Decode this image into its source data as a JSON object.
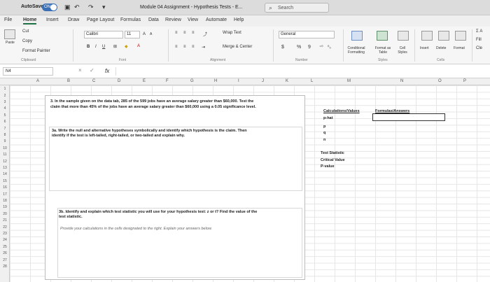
{
  "titlebar": {
    "autosave_label": "AutoSave",
    "autosave_state": "ON",
    "title": "Module 04 Assignment - Hypothesis Tests - E...",
    "search_placeholder": "Search"
  },
  "tabs": [
    "File",
    "Home",
    "Insert",
    "Draw",
    "Page Layout",
    "Formulas",
    "Data",
    "Review",
    "View",
    "Automate",
    "Help"
  ],
  "ribbon": {
    "clipboard": {
      "cut": "Cut",
      "copy": "Copy",
      "paste": "Paste",
      "format_painter": "Format Painter",
      "label": "Clipboard"
    },
    "font": {
      "name": "Calibri",
      "size": "11",
      "bold": "B",
      "italic": "I",
      "underline": "U",
      "grow": "A",
      "shrink": "A",
      "label": "Font"
    },
    "alignment": {
      "wrap": "Wrap Text",
      "merge": "Merge & Center",
      "label": "Alignment"
    },
    "number": {
      "format": "General",
      "currency": "$",
      "percent": "%",
      "comma": "9",
      "label": "Number"
    },
    "styles": {
      "conditional": "Conditional Formatting",
      "format_table": "Format as Table",
      "cell_styles": "Cell Styles",
      "label": "Styles"
    },
    "cells": {
      "insert": "Insert",
      "delete": "Delete",
      "format": "Format",
      "label": "Cells"
    },
    "editing": {
      "sum": "Σ A",
      "fill": "Fill",
      "clear": "Cle"
    }
  },
  "formula_bar": {
    "name_box": "N4",
    "fx": "fx",
    "cancel": "×",
    "enter": "✓"
  },
  "columns": [
    "A",
    "B",
    "C",
    "D",
    "E",
    "F",
    "G",
    "H",
    "I",
    "J",
    "K",
    "L",
    "M",
    "N",
    "O",
    "P"
  ],
  "rows": [
    "1",
    "2",
    "3",
    "4",
    "5",
    "6",
    "7",
    "8",
    "9",
    "10",
    "11",
    "12",
    "13",
    "14",
    "15",
    "16",
    "17",
    "18",
    "19",
    "20",
    "21",
    "22",
    "23",
    "24",
    "25",
    "26",
    "27",
    "28"
  ],
  "content": {
    "q3_line1": "3. In the sample given on the data tab, 285 of the 599 jobs have an average salary greater than $60,000. Test the",
    "q3_line2": "claim that more than 45% of the jobs have an average salary greater than $60,000 using a 0.05 significance level.",
    "q3a_line1": "3a. Write the null and alternative hypotheses symbolically and identify which hypothesis is the claim. Then",
    "q3a_line2": "identify if the test is left-tailed, right-tailed, or two-tailed and explain why.",
    "q3b_line1": "3b. Identify and explain which test statistic you will use for your hypothesis test: z or t? Find the value of the",
    "q3b_line2": "test statistic.",
    "instruction": "Provide your calculations in the cells designated to the right. Explain your answers below."
  },
  "side": {
    "calc_header": "Calculations/Values",
    "ans_header": "Formulas/Answers",
    "p_hat": "p-hat",
    "p": "p",
    "q": "q",
    "n": "n",
    "test_stat": "Test Statistic",
    "critical": "Critical Value",
    "pvalue": "P-value"
  }
}
